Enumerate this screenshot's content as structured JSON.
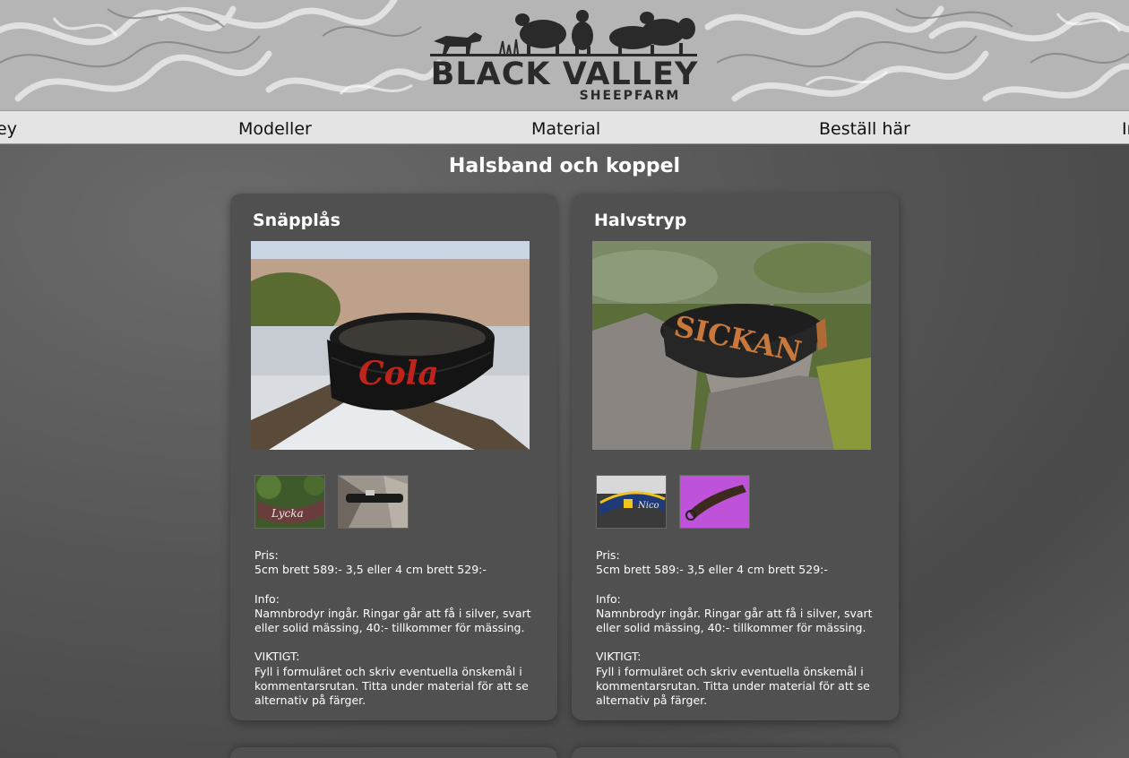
{
  "header": {
    "logo_title": "BLACK VALLEY",
    "logo_subtitle": "SHEEPFARM"
  },
  "nav": {
    "items": [
      "ey",
      "Modeller",
      "Material",
      "Beställ här",
      "In"
    ]
  },
  "page": {
    "title": "Halsband och koppel"
  },
  "products": [
    {
      "title": "Snäpplås",
      "photo_text": "Cola",
      "thumb1_text": "Lycka",
      "price_label": "Pris:",
      "price_text": "5cm brett 589:- 3,5 eller 4 cm brett 529:-",
      "info_label": "Info:",
      "info_text": "Namnbrodyr ingår. Ringar går att få i silver, svart eller solid mässing, 40:- tillkommer för mässing.",
      "important_label": "VIKTIGT:",
      "important_text": "Fyll i formuläret och skriv eventuella önskemål i kommentarsrutan. Titta under material för att se alternativ på färger."
    },
    {
      "title": "Halvstryp",
      "photo_text": "SICKAN",
      "thumb1_text": "Nico",
      "price_label": "Pris:",
      "price_text": "5cm brett 589:- 3,5 eller 4 cm brett 529:-",
      "info_label": "Info:",
      "info_text": "Namnbrodyr ingår. Ringar går att få i silver, svart eller solid mässing, 40:- tillkommer för mässing.",
      "important_label": "VIKTIGT:",
      "important_text": "Fyll i formuläret och skriv eventuella önskemål i kommentarsrutan. Titta under material för att se alternativ på färger."
    }
  ],
  "colors": {
    "background": "#5a5a5a",
    "card": "#505050",
    "nav": "#e4e4e4",
    "logo": "#2a2a2a",
    "embroidery_red": "#c0231b",
    "embroidery_orange": "#c8783a"
  }
}
